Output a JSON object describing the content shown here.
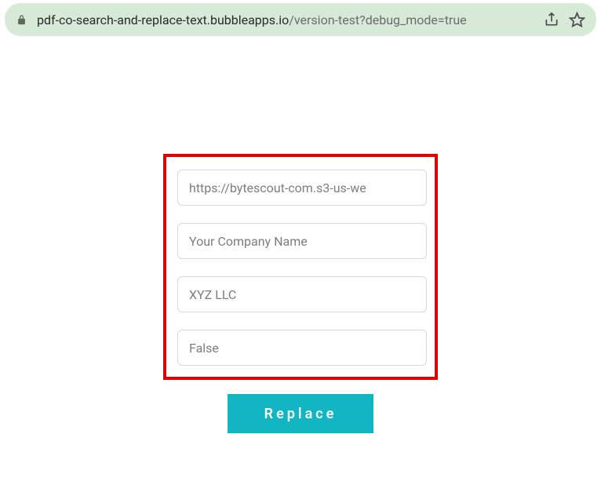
{
  "addressbar": {
    "url_host": "pdf-co-search-and-replace-text.bubbleapps.io",
    "url_path": "/version-test?debug_mode=true"
  },
  "form": {
    "input_url": "https://bytescout-com.s3-us-we",
    "input_search": "Your Company Name",
    "input_replace": "XYZ LLC",
    "input_flag": "False",
    "button_label": "Replace"
  }
}
